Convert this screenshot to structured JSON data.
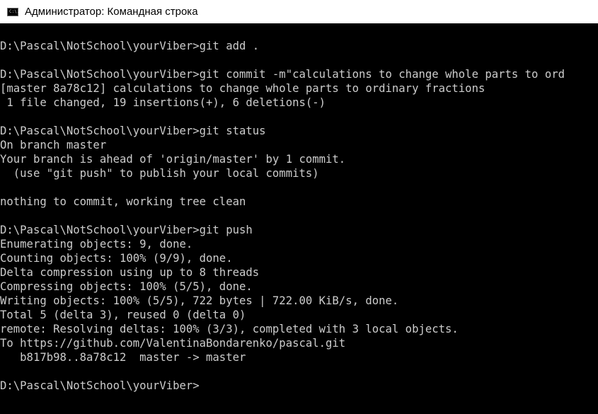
{
  "window": {
    "title": "Администратор: Командная строка",
    "icon": "cmd-icon",
    "icon_glyph": "C:\\."
  },
  "colors": {
    "titlebar_bg": "#ffffff",
    "console_bg": "#000000",
    "console_fg": "#cccccc"
  },
  "console": {
    "lines": [
      "D:\\Pascal\\NotSchool\\yourViber>git add .",
      "",
      "D:\\Pascal\\NotSchool\\yourViber>git commit -m\"calculations to change whole parts to ord",
      "[master 8a78c12] calculations to change whole parts to ordinary fractions",
      " 1 file changed, 19 insertions(+), 6 deletions(-)",
      "",
      "D:\\Pascal\\NotSchool\\yourViber>git status",
      "On branch master",
      "Your branch is ahead of 'origin/master' by 1 commit.",
      "  (use \"git push\" to publish your local commits)",
      "",
      "nothing to commit, working tree clean",
      "",
      "D:\\Pascal\\NotSchool\\yourViber>git push",
      "Enumerating objects: 9, done.",
      "Counting objects: 100% (9/9), done.",
      "Delta compression using up to 8 threads",
      "Compressing objects: 100% (5/5), done.",
      "Writing objects: 100% (5/5), 722 bytes | 722.00 KiB/s, done.",
      "Total 5 (delta 3), reused 0 (delta 0)",
      "remote: Resolving deltas: 100% (3/3), completed with 3 local objects.",
      "To https://github.com/ValentinaBondarenko/pascal.git",
      "   b817b98..8a78c12  master -> master",
      "",
      "D:\\Pascal\\NotSchool\\yourViber>"
    ]
  }
}
